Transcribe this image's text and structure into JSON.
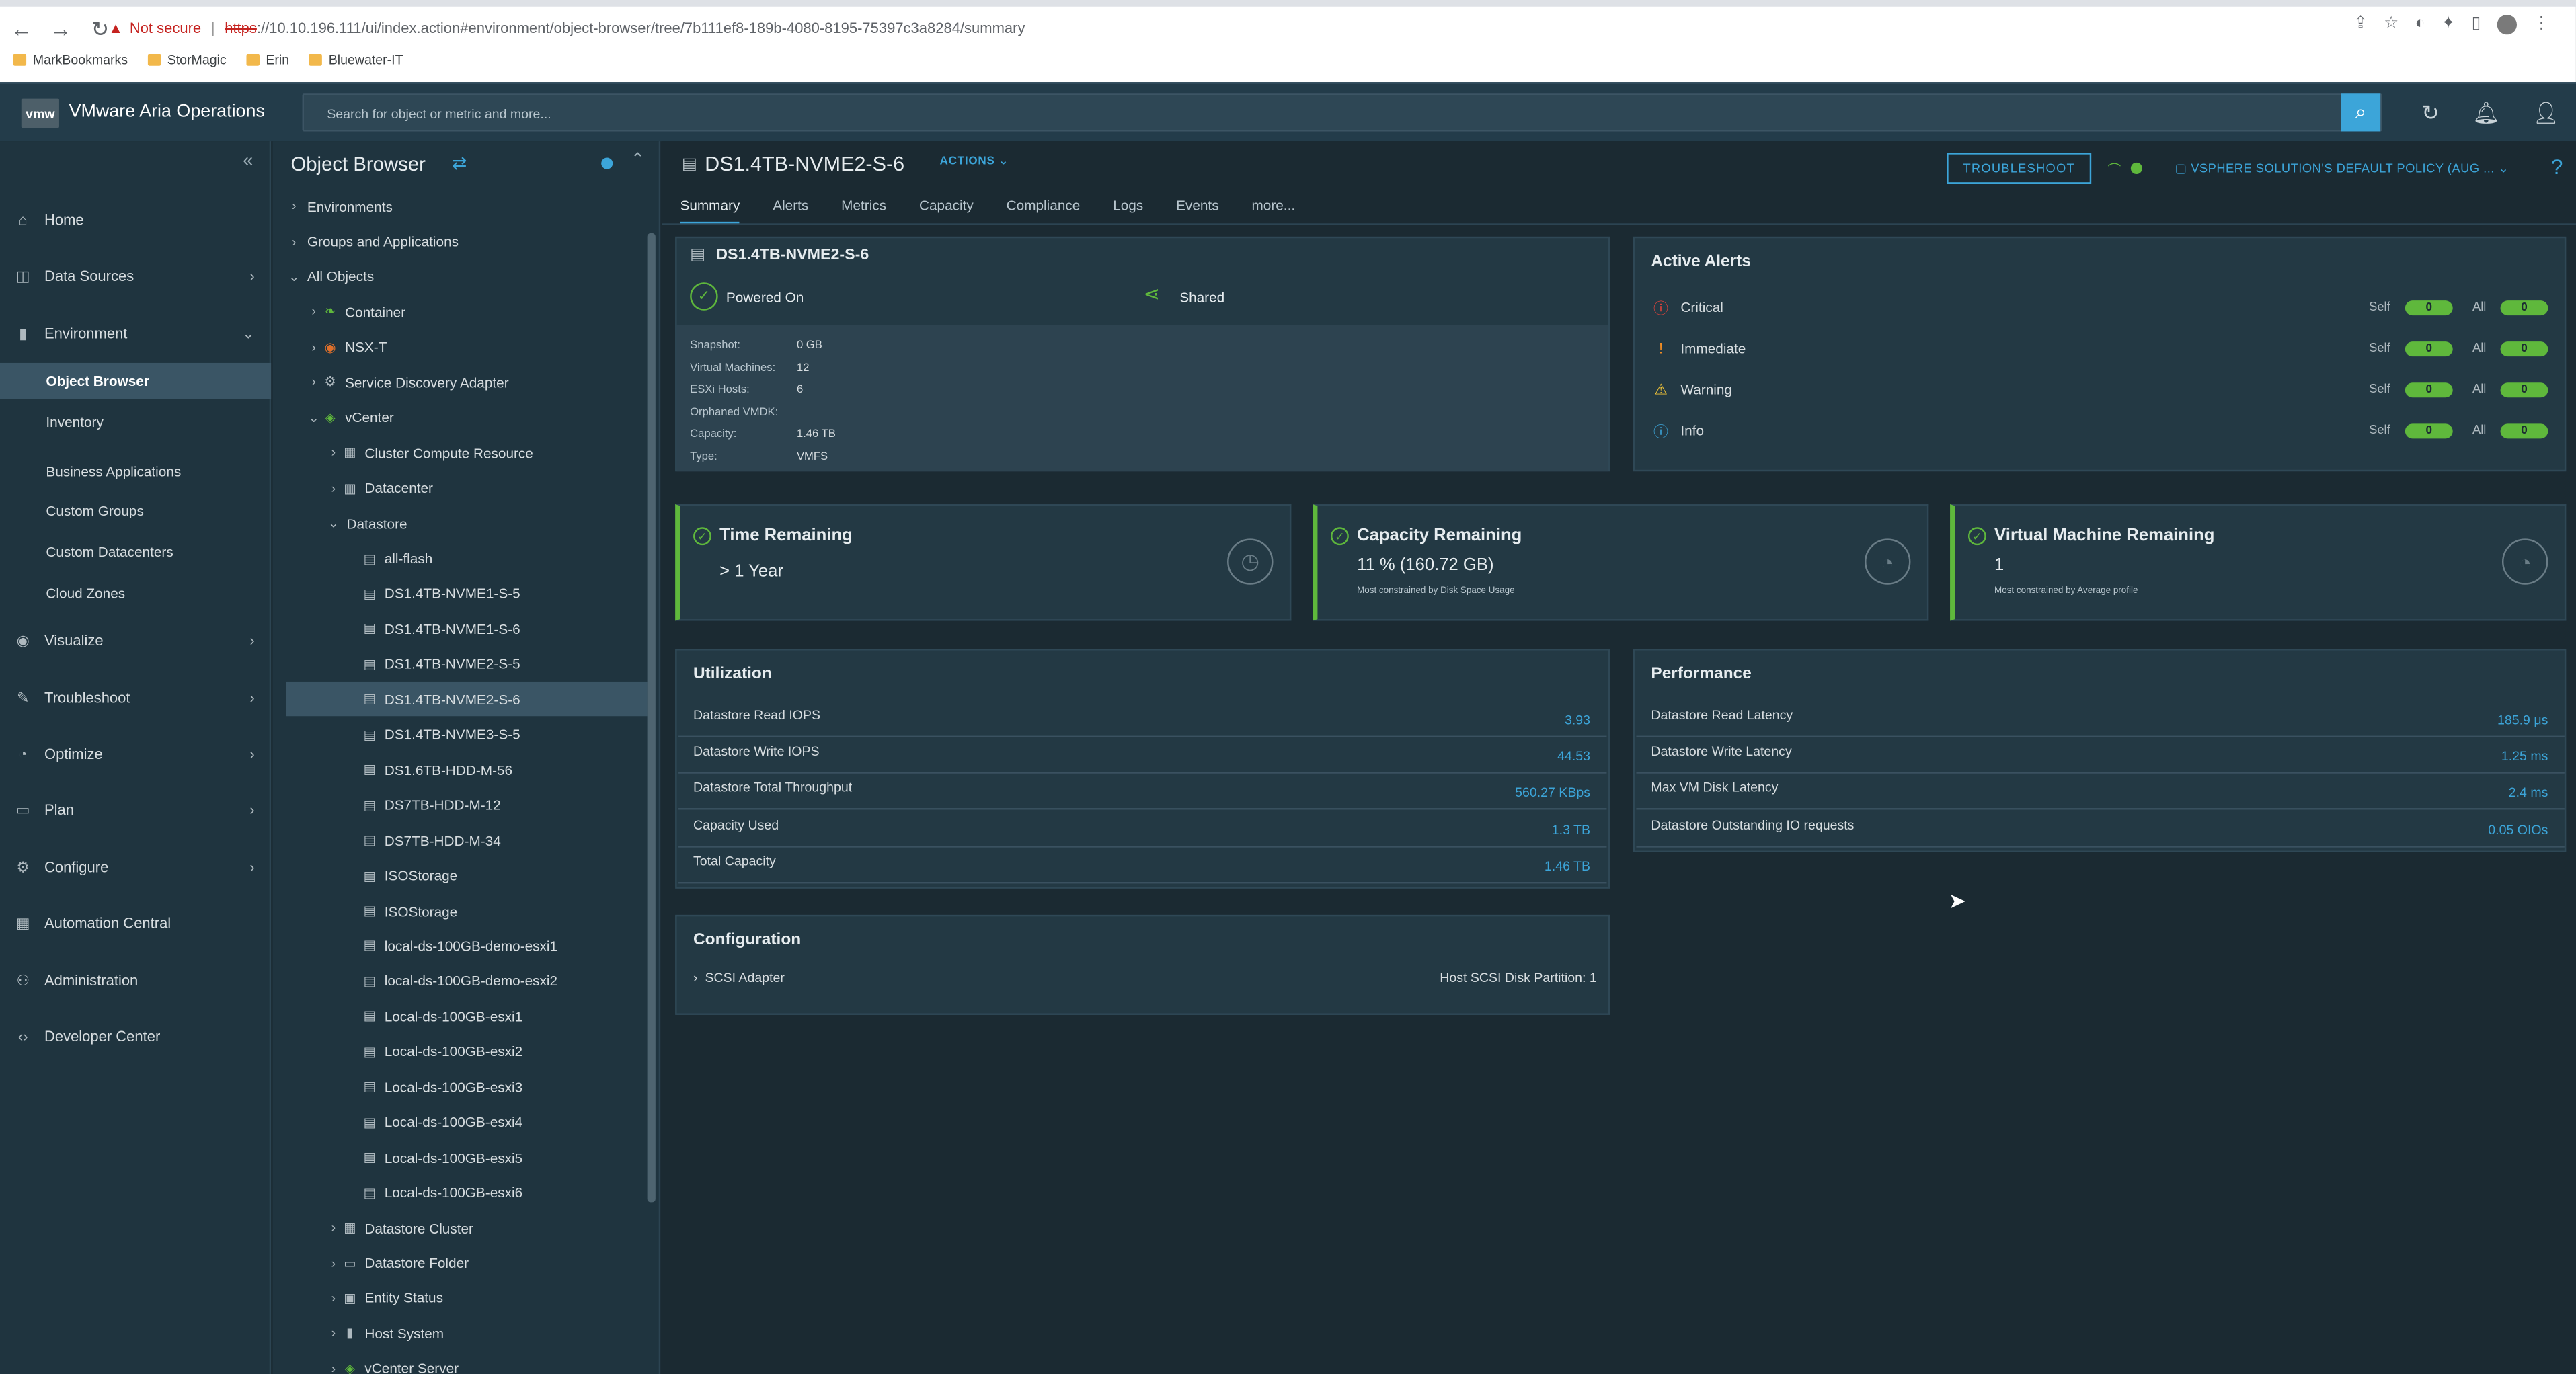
{
  "browser": {
    "not_secure": "Not secure",
    "url_scheme": "https",
    "url_rest": "://10.10.196.111/ui/index.action#environment/object-browser/tree/7b111ef8-189b-4080-8195-75397c3a8284/summary",
    "bookmarks": [
      "MarkBookmarks",
      "StorMagic",
      "Erin",
      "Bluewater-IT"
    ]
  },
  "app": {
    "logo": "vmw",
    "title": "VMware Aria Operations",
    "search_placeholder": "Search for object or metric and more..."
  },
  "nav": {
    "items": [
      {
        "label": "Home",
        "icon": "home-icon"
      },
      {
        "label": "Data Sources",
        "icon": "database-icon"
      },
      {
        "label": "Environment",
        "icon": "chart-icon"
      },
      {
        "label": "Visualize",
        "icon": "eye-icon"
      },
      {
        "label": "Troubleshoot",
        "icon": "wrench-icon"
      },
      {
        "label": "Optimize",
        "icon": "gauge-icon"
      },
      {
        "label": "Plan",
        "icon": "folder-icon"
      },
      {
        "label": "Configure",
        "icon": "gear-icon"
      },
      {
        "label": "Automation Central",
        "icon": "calendar-icon"
      },
      {
        "label": "Administration",
        "icon": "users-icon"
      },
      {
        "label": "Developer Center",
        "icon": "code-icon"
      }
    ],
    "env_sub": [
      "Object Browser",
      "Inventory",
      "Business Applications",
      "Custom Groups",
      "Custom Datacenters",
      "Cloud Zones"
    ]
  },
  "tree": {
    "title": "Object Browser",
    "rows": [
      {
        "label": "Environments",
        "indent": 0,
        "chev": "›",
        "icon": ""
      },
      {
        "label": "Groups and Applications",
        "indent": 0,
        "chev": "›",
        "icon": ""
      },
      {
        "label": "All Objects",
        "indent": 0,
        "chev": "⌄",
        "icon": ""
      },
      {
        "label": "Container",
        "indent": 1,
        "chev": "›",
        "icon": "leaf"
      },
      {
        "label": "NSX-T",
        "indent": 1,
        "chev": "›",
        "icon": "nsx"
      },
      {
        "label": "Service Discovery Adapter",
        "indent": 1,
        "chev": "›",
        "icon": "sda"
      },
      {
        "label": "vCenter",
        "indent": 1,
        "chev": "⌄",
        "icon": "vc"
      },
      {
        "label": "Cluster Compute Resource",
        "indent": 2,
        "chev": "›",
        "icon": "cl"
      },
      {
        "label": "Datacenter",
        "indent": 2,
        "chev": "›",
        "icon": "dc"
      },
      {
        "label": "Datastore",
        "indent": 2,
        "chev": "⌄",
        "icon": ""
      },
      {
        "label": "all-flash",
        "indent": 3,
        "chev": "",
        "icon": "ds"
      },
      {
        "label": "DS1.4TB-NVME1-S-5",
        "indent": 3,
        "chev": "",
        "icon": "ds"
      },
      {
        "label": "DS1.4TB-NVME1-S-6",
        "indent": 3,
        "chev": "",
        "icon": "ds"
      },
      {
        "label": "DS1.4TB-NVME2-S-5",
        "indent": 3,
        "chev": "",
        "icon": "ds"
      },
      {
        "label": "DS1.4TB-NVME2-S-6",
        "indent": 3,
        "chev": "",
        "icon": "ds",
        "selected": true
      },
      {
        "label": "DS1.4TB-NVME3-S-5",
        "indent": 3,
        "chev": "",
        "icon": "ds"
      },
      {
        "label": "DS1.6TB-HDD-M-56",
        "indent": 3,
        "chev": "",
        "icon": "ds"
      },
      {
        "label": "DS7TB-HDD-M-12",
        "indent": 3,
        "chev": "",
        "icon": "ds"
      },
      {
        "label": "DS7TB-HDD-M-34",
        "indent": 3,
        "chev": "",
        "icon": "ds"
      },
      {
        "label": "ISOStorage",
        "indent": 3,
        "chev": "",
        "icon": "ds"
      },
      {
        "label": "ISOStorage",
        "indent": 3,
        "chev": "",
        "icon": "ds"
      },
      {
        "label": "local-ds-100GB-demo-esxi1",
        "indent": 3,
        "chev": "",
        "icon": "ds"
      },
      {
        "label": "local-ds-100GB-demo-esxi2",
        "indent": 3,
        "chev": "",
        "icon": "ds"
      },
      {
        "label": "Local-ds-100GB-esxi1",
        "indent": 3,
        "chev": "",
        "icon": "ds"
      },
      {
        "label": "Local-ds-100GB-esxi2",
        "indent": 3,
        "chev": "",
        "icon": "ds"
      },
      {
        "label": "Local-ds-100GB-esxi3",
        "indent": 3,
        "chev": "",
        "icon": "ds"
      },
      {
        "label": "Local-ds-100GB-esxi4",
        "indent": 3,
        "chev": "",
        "icon": "ds"
      },
      {
        "label": "Local-ds-100GB-esxi5",
        "indent": 3,
        "chev": "",
        "icon": "ds"
      },
      {
        "label": "Local-ds-100GB-esxi6",
        "indent": 3,
        "chev": "",
        "icon": "ds"
      },
      {
        "label": "Datastore Cluster",
        "indent": 2,
        "chev": "›",
        "icon": "dsc"
      },
      {
        "label": "Datastore Folder",
        "indent": 2,
        "chev": "›",
        "icon": "fold"
      },
      {
        "label": "Entity Status",
        "indent": 2,
        "chev": "›",
        "icon": "es"
      },
      {
        "label": "Host System",
        "indent": 2,
        "chev": "›",
        "icon": "host"
      },
      {
        "label": "vCenter Server",
        "indent": 2,
        "chev": "›",
        "icon": "vc"
      }
    ]
  },
  "object": {
    "title": "DS1.4TB-NVME2-S-6",
    "actions": "ACTIONS",
    "troubleshoot": "TROUBLESHOOT",
    "policy": "VSPHERE SOLUTION'S DEFAULT POLICY (AUG ...",
    "tabs": [
      "Summary",
      "Alerts",
      "Metrics",
      "Capacity",
      "Compliance",
      "Logs",
      "Events",
      "more..."
    ]
  },
  "summary": {
    "name": "DS1.4TB-NVME2-S-6",
    "power": "Powered On",
    "shared": "Shared",
    "props": [
      {
        "k": "Snapshot:",
        "v": "0 GB"
      },
      {
        "k": "Virtual Machines:",
        "v": "12"
      },
      {
        "k": "ESXi Hosts:",
        "v": "6"
      },
      {
        "k": "Orphaned VMDK:",
        "v": ""
      },
      {
        "k": "Capacity:",
        "v": "1.46 TB"
      },
      {
        "k": "Type:",
        "v": "VMFS"
      }
    ]
  },
  "alerts": {
    "title": "Active Alerts",
    "self_label": "Self",
    "all_label": "All",
    "rows": [
      {
        "name": "Critical",
        "icon": "critical-icon",
        "color": "#e0433b",
        "self": "0",
        "all": "0"
      },
      {
        "name": "Immediate",
        "icon": "immediate-icon",
        "color": "#f08c23",
        "self": "0",
        "all": "0"
      },
      {
        "name": "Warning",
        "icon": "warning-icon",
        "color": "#f2c437",
        "self": "0",
        "all": "0"
      },
      {
        "name": "Info",
        "icon": "info-icon",
        "color": "#3ca5d9",
        "self": "0",
        "all": "0"
      }
    ]
  },
  "remaining": [
    {
      "title": "Time Remaining",
      "value": "> 1 Year",
      "sub": ""
    },
    {
      "title": "Capacity Remaining",
      "value": "11 % (160.72 GB)",
      "sub": "Most constrained by Disk Space Usage"
    },
    {
      "title": "Virtual Machine Remaining",
      "value": "1",
      "sub": "Most constrained by Average profile"
    }
  ],
  "utilization": {
    "title": "Utilization",
    "rows": [
      {
        "k": "Datastore Read IOPS",
        "v": "3.93"
      },
      {
        "k": "Datastore Write IOPS",
        "v": "44.53"
      },
      {
        "k": "Datastore Total Throughput",
        "v": "560.27 KBps"
      },
      {
        "k": "Capacity Used",
        "v": "1.3 TB"
      },
      {
        "k": "Total Capacity",
        "v": "1.46 TB"
      }
    ]
  },
  "performance": {
    "title": "Performance",
    "rows": [
      {
        "k": "Datastore Read Latency",
        "v": "185.9 μs"
      },
      {
        "k": "Datastore Write Latency",
        "v": "1.25 ms"
      },
      {
        "k": "Max VM Disk Latency",
        "v": "2.4 ms"
      },
      {
        "k": "Datastore Outstanding IO requests",
        "v": "0.05 OIOs"
      }
    ]
  },
  "configuration": {
    "title": "Configuration",
    "row_label": "SCSI Adapter",
    "row_value": "Host SCSI Disk Partition: 1"
  }
}
